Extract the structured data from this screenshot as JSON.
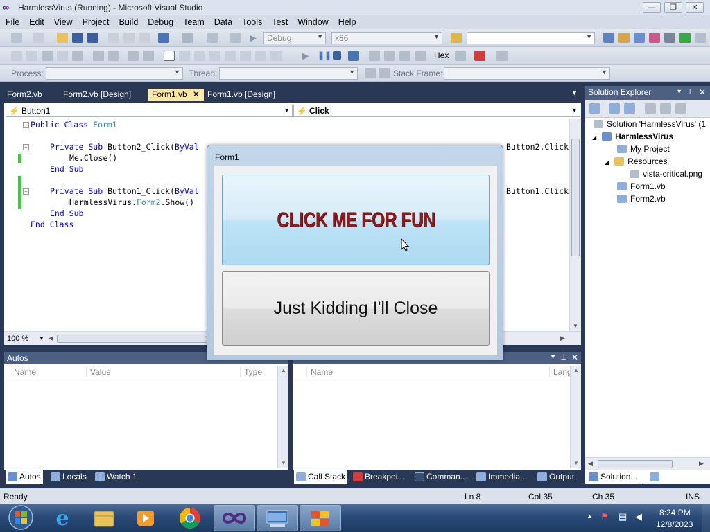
{
  "window": {
    "title": "HarmlessVirus (Running) - Microsoft Visual Studio",
    "controls": [
      "—",
      "❐",
      "✕"
    ]
  },
  "menu": [
    "File",
    "Edit",
    "View",
    "Project",
    "Build",
    "Debug",
    "Team",
    "Data",
    "Tools",
    "Test",
    "Window",
    "Help"
  ],
  "toolbar": {
    "config": "Debug",
    "platform": "x86",
    "hex_label": "Hex",
    "process_label": "Process:",
    "thread_label": "Thread:",
    "stackframe_label": "Stack Frame:"
  },
  "doc_tabs": [
    "Form2.vb",
    "Form2.vb [Design]",
    "Form1.vb",
    "Form1.vb [Design]"
  ],
  "active_tab": "Form1.vb",
  "editor": {
    "class_dropdown": "Button1",
    "method_dropdown": "Click",
    "zoom": "100 %",
    "lines": [
      {
        "kw1": "Public Class ",
        "ty": "Form1",
        "rest": ""
      },
      {
        "kw1": "Private Sub ",
        "rest": "Button2_Click(",
        "kw2": "ByVal",
        "tail": "Button2.Click"
      },
      {
        "text": "Me.Close()"
      },
      {
        "kw1": "End Sub"
      },
      {
        "kw1": "Private Sub ",
        "rest": "Button1_Click(",
        "kw2": "ByVal",
        "tail": "Button1.Click"
      },
      {
        "pre": "HarmlessVirus.",
        "ty": "Form2",
        "post": ".Show()"
      },
      {
        "kw1": "End Sub"
      },
      {
        "kw1": "End Class"
      }
    ]
  },
  "form1": {
    "title": "Form1",
    "fun_button": "CLICK ME FOR FUN",
    "close_button": "Just Kidding I'll Close"
  },
  "autos": {
    "title": "Autos",
    "columns": [
      "Name",
      "Value",
      "Type"
    ],
    "tabs": [
      "Autos",
      "Locals",
      "Watch 1"
    ]
  },
  "callstack": {
    "columns": [
      "Name",
      "Lang"
    ],
    "tabs": [
      "Call Stack",
      "Breakpoi...",
      "Comman...",
      "Immedia...",
      "Output"
    ]
  },
  "solution_explorer": {
    "title": "Solution Explorer",
    "items": [
      "Solution 'HarmlessVirus' (1",
      "HarmlessVirus",
      "My Project",
      "Resources",
      "vista-critical.png",
      "Form1.vb",
      "Form2.vb"
    ],
    "tabs": [
      "Solution...",
      "Team Ex..."
    ]
  },
  "status": {
    "text": "Ready",
    "ln": "Ln 8",
    "col": "Col 35",
    "ch": "Ch 35",
    "mode": "INS"
  },
  "taskbar": {
    "time": "8:24 PM",
    "date": "12/8/2023"
  }
}
